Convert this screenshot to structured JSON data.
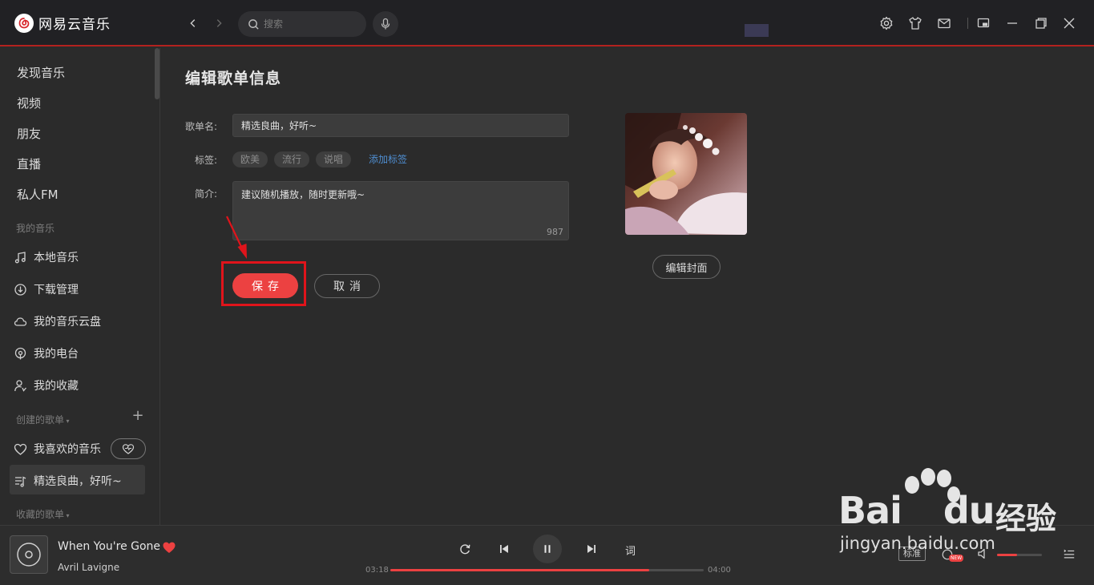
{
  "app": {
    "name": "网易云音乐",
    "accent": "#ec4141"
  },
  "topbar": {
    "back_icon": "chevron-left-icon",
    "forward_icon": "chevron-right-icon",
    "search_placeholder": "搜索",
    "icons": [
      "settings-icon",
      "skin-icon",
      "mail-icon",
      "mini-mode-icon",
      "maximize-icon",
      "close-icon"
    ]
  },
  "sidebar": {
    "main_items": [
      {
        "label": "发现音乐"
      },
      {
        "label": "视频"
      },
      {
        "label": "朋友"
      },
      {
        "label": "直播"
      },
      {
        "label": "私人FM"
      }
    ],
    "my_music_header": "我的音乐",
    "my_music_items": [
      {
        "label": "本地音乐",
        "icon": "music-note-icon"
      },
      {
        "label": "下载管理",
        "icon": "download-icon"
      },
      {
        "label": "我的音乐云盘",
        "icon": "cloud-icon"
      },
      {
        "label": "我的电台",
        "icon": "radio-icon"
      },
      {
        "label": "我的收藏",
        "icon": "collect-icon"
      }
    ],
    "created_header": "创建的歌单",
    "created_items": [
      {
        "label": "我喜欢的音乐",
        "icon": "heart-outline-icon"
      },
      {
        "label": "精选良曲，好听~",
        "icon": "playlist-icon"
      }
    ],
    "collected_header": "收藏的歌单"
  },
  "editor": {
    "title": "编辑歌单信息",
    "name_label": "歌单名:",
    "name_value": "精选良曲，好听~",
    "tags_label": "标签:",
    "tags": [
      "欧美",
      "流行",
      "说唱"
    ],
    "add_tag": "添加标签",
    "intro_label": "简介:",
    "intro_value": "建议随机播放，随时更新哦~",
    "intro_remaining": "987",
    "save": "保存",
    "cancel": "取消",
    "edit_cover": "编辑封面"
  },
  "player": {
    "song": "When You're Gone",
    "artist": "Avril Lavigne",
    "current_time": "03:18",
    "total_time": "04:00",
    "progress": 0.825,
    "lyric_button": "词",
    "quality": "标准",
    "volume": 0.45,
    "new_badge": "NEW"
  },
  "watermark": {
    "brand": "Bai",
    "brand_end": "du",
    "jingyan": "经验",
    "url": "jingyan.baidu.com"
  }
}
